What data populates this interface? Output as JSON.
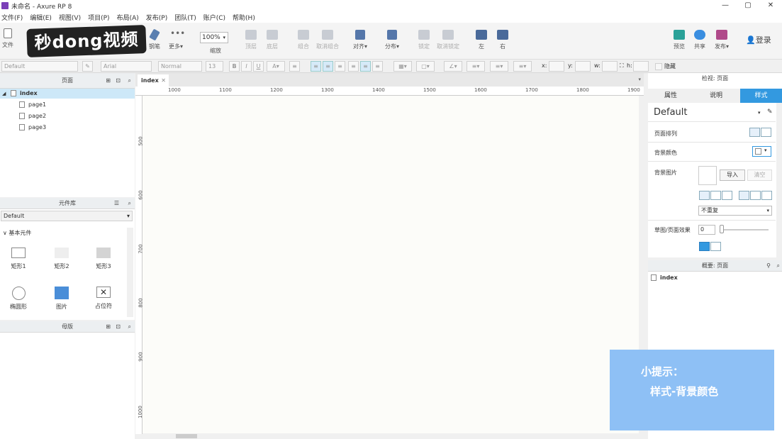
{
  "window": {
    "title": "未命名 - Axure RP 8",
    "min": "—",
    "max": "▢",
    "close": "✕"
  },
  "menu": [
    "文件(F)",
    "编辑(E)",
    "视图(V)",
    "项目(P)",
    "布局(A)",
    "发布(P)",
    "团队(T)",
    "账户(C)",
    "帮助(H)"
  ],
  "toolbar": {
    "file": "文件",
    "pen": "钢笔",
    "more": "更多▾",
    "zoom_value": "100%",
    "zoom_label": "缩放",
    "top": "顶层",
    "bottom": "底层",
    "group": "组合",
    "ungroup": "取消组合",
    "align": "对齐▾",
    "distribute": "分布▾",
    "lock": "锁定",
    "unlock": "取消锁定",
    "left": "左",
    "right": "右",
    "preview": "预览",
    "share": "共享",
    "publish": "发布▾",
    "login": "登录"
  },
  "logo_text": "秒dong视频",
  "format": {
    "style": "Default",
    "font": "Arial",
    "weight": "Normal",
    "size": "13",
    "x_label": "x:",
    "y_label": "y:",
    "w_label": "w:",
    "h_label": "h:",
    "hide_label": "隐藏"
  },
  "pages_panel": {
    "title": "页面",
    "items": [
      "index",
      "page1",
      "page2",
      "page3"
    ]
  },
  "library_panel": {
    "title": "元件库",
    "selected": "Default",
    "group": "基本元件",
    "widgets": [
      "矩形1",
      "矩形2",
      "矩形3",
      "椭圆形",
      "图片",
      "占位符"
    ]
  },
  "masters_panel": {
    "title": "母版"
  },
  "canvas": {
    "tab": "index",
    "ruler_top": [
      "1000",
      "1100",
      "1200",
      "1300",
      "1400",
      "1500",
      "1600",
      "1700",
      "1800",
      "1900"
    ],
    "ruler_left": [
      "500",
      "600",
      "700",
      "800",
      "900",
      "1000"
    ]
  },
  "inspector": {
    "title": "检视: 页面",
    "tabs": [
      "属性",
      "说明",
      "样式"
    ],
    "style_name": "Default",
    "page_align": "页面排列",
    "bg_color": "背景颜色",
    "bg_image": "背景图片",
    "import": "导入",
    "clear": "清空",
    "repeat": "不重复",
    "sketch": "草图/页面效果",
    "sketch_value": "0"
  },
  "outline": {
    "title": "概要: 页面",
    "item": "index"
  },
  "tip": {
    "line1": "小提示：",
    "line2": "样式-背景颜色"
  },
  "colors": {
    "accent": "#3399e0",
    "tip_bg": "#8ec0f5"
  }
}
